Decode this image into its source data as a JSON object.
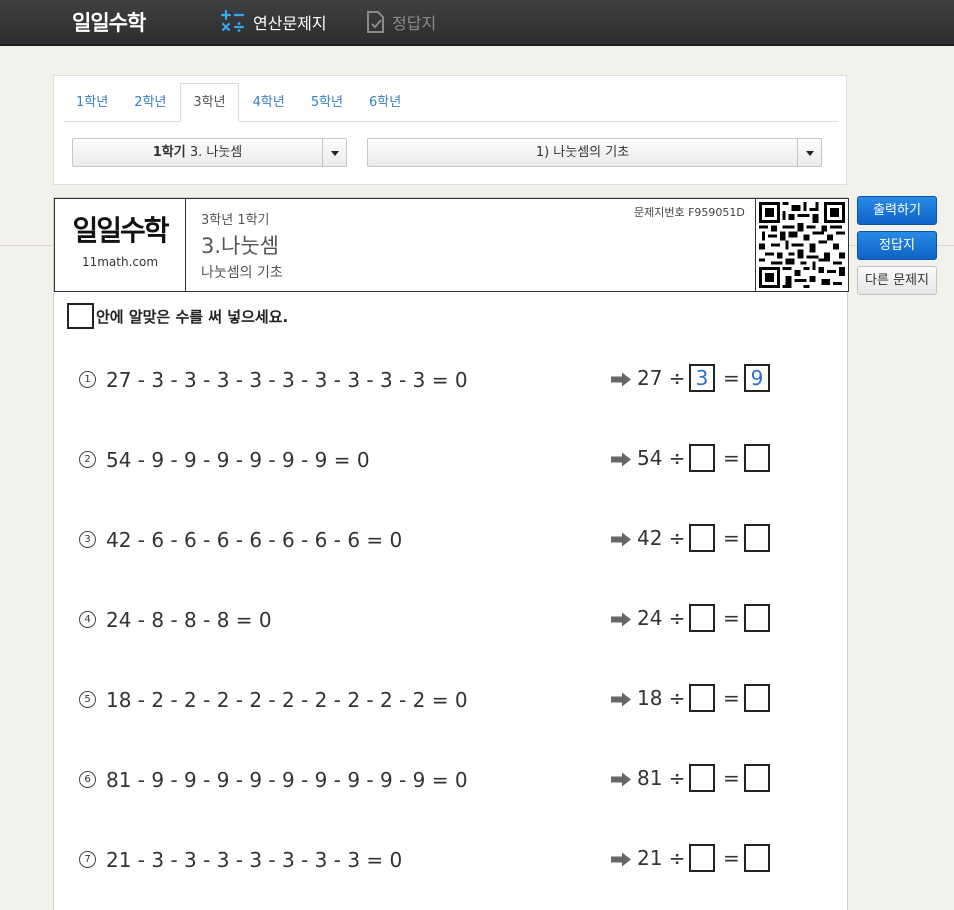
{
  "topbar": {
    "logo": "일일수학",
    "nav_problems": "연산문제지",
    "nav_answers": "정답지"
  },
  "grades": [
    "1학년",
    "2학년",
    "3학년",
    "4학년",
    "5학년",
    "6학년"
  ],
  "selected_grade": "3학년",
  "select_chapter": {
    "semester": "1학기",
    "chapter": "3. 나눗셈"
  },
  "select_topic": "1) 나눗셈의 기초",
  "sheet": {
    "brand": "일일수학",
    "site": "11math.com",
    "grade_semester": "3학년 1학기",
    "unit": "3.나눗셈",
    "topic": "나눗셈의 기초",
    "sheet_id": "문제지번호 F959051D",
    "instruction": "안에 알맞은 수를 써 넣으세요."
  },
  "problems": [
    {
      "num": "1",
      "expr": "27 - 3 - 3 - 3 - 3 - 3 - 3 - 3 - 3 - 3 = 0",
      "dividend": "27 ÷",
      "eq": "=",
      "answer1": "3",
      "answer2": "9"
    },
    {
      "num": "2",
      "expr": "54 - 9 - 9 - 9 - 9 - 9 - 9 = 0",
      "dividend": "54 ÷",
      "eq": "=",
      "answer1": "",
      "answer2": ""
    },
    {
      "num": "3",
      "expr": "42 - 6 - 6 - 6 - 6 - 6 - 6 - 6 = 0",
      "dividend": "42 ÷",
      "eq": "=",
      "answer1": "",
      "answer2": ""
    },
    {
      "num": "4",
      "expr": "24 - 8 - 8 - 8 = 0",
      "dividend": "24 ÷",
      "eq": "=",
      "answer1": "",
      "answer2": ""
    },
    {
      "num": "5",
      "expr": "18 - 2 - 2 - 2 - 2 - 2 - 2 - 2 - 2 - 2 = 0",
      "dividend": "18 ÷",
      "eq": "=",
      "answer1": "",
      "answer2": ""
    },
    {
      "num": "6",
      "expr": "81 - 9 - 9 - 9 - 9 - 9 - 9 - 9 - 9 - 9 = 0",
      "dividend": "81 ÷",
      "eq": "=",
      "answer1": "",
      "answer2": ""
    },
    {
      "num": "7",
      "expr": "21 - 3 - 3 - 3 - 3 - 3 - 3 - 3 = 0",
      "dividend": "21 ÷",
      "eq": "=",
      "answer1": "",
      "answer2": ""
    }
  ],
  "buttons": {
    "print": "출력하기",
    "answer": "정답지",
    "other": "다른 문제지"
  }
}
